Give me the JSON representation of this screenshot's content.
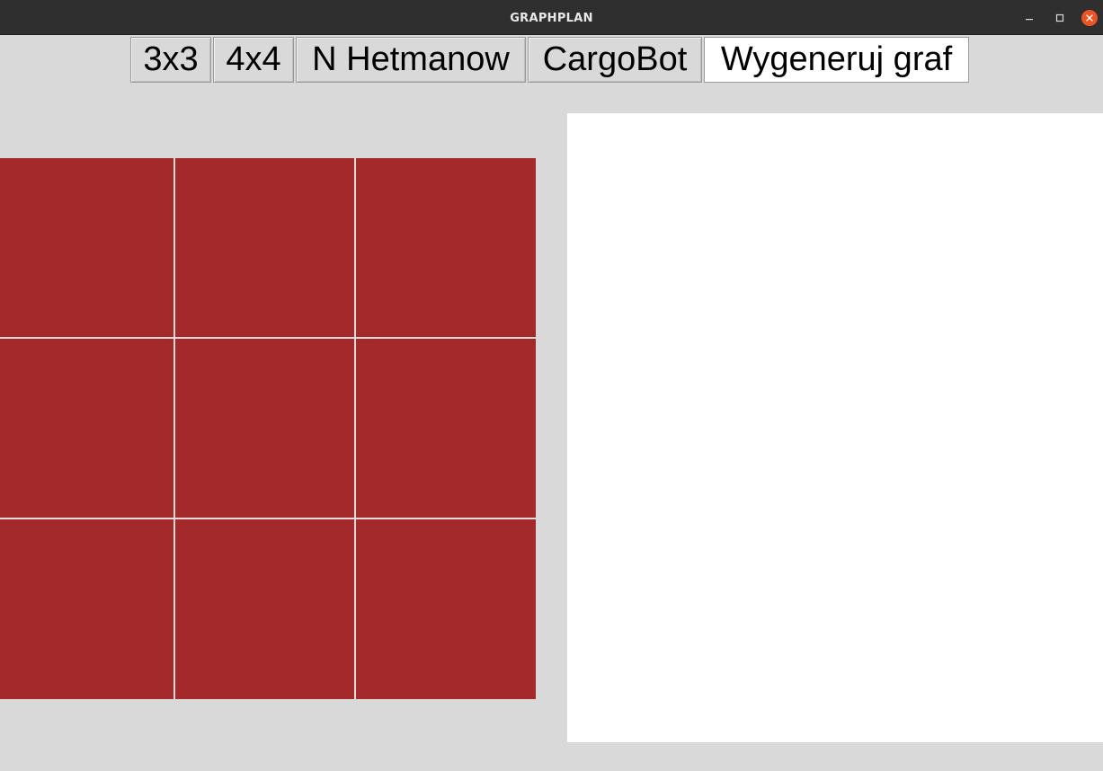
{
  "window": {
    "title": "GRAPHPLAN",
    "controls": {
      "minimize": "minimize-icon",
      "maximize": "maximize-icon",
      "close": "close-icon"
    }
  },
  "toolbar": {
    "buttons": [
      {
        "label": "3x3",
        "active": false
      },
      {
        "label": "4x4",
        "active": false
      },
      {
        "label": "N Hetmanow",
        "active": false
      },
      {
        "label": "CargoBot",
        "active": false
      },
      {
        "label": "Wygeneruj graf",
        "active": true
      }
    ]
  },
  "board": {
    "rows": 3,
    "cols": 3,
    "cell_color": "#a4292a",
    "grid_line_color": "#e8d9d9"
  },
  "colors": {
    "background": "#d9d9d9",
    "titlebar": "#2f2f2f",
    "close_button": "#e95420",
    "graph_canvas": "#ffffff"
  }
}
